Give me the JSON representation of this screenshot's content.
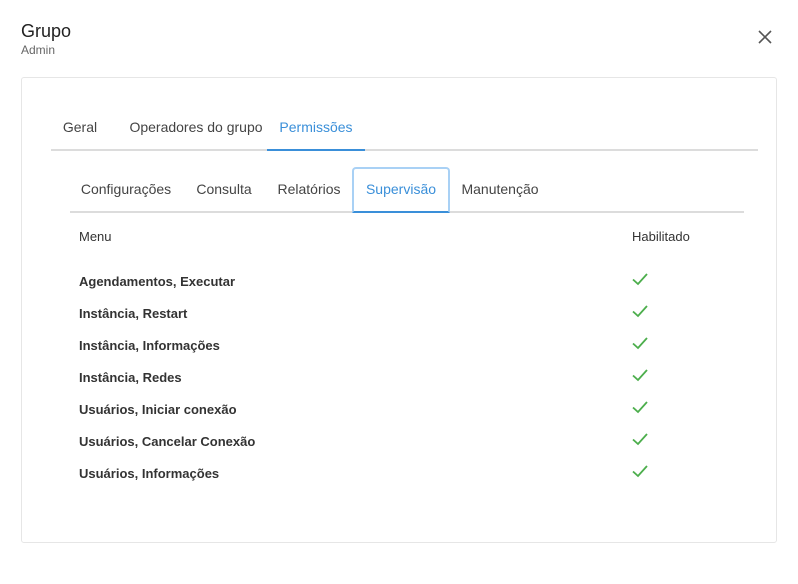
{
  "header": {
    "title": "Grupo",
    "subtitle": "Admin"
  },
  "tabs_main": [
    {
      "label": "Geral",
      "active": false
    },
    {
      "label": "Operadores do grupo",
      "active": false
    },
    {
      "label": "Permissões",
      "active": true
    }
  ],
  "tabs_sub": [
    {
      "label": "Configurações",
      "active": false
    },
    {
      "label": "Consulta",
      "active": false
    },
    {
      "label": "Relatórios",
      "active": false
    },
    {
      "label": "Supervisão",
      "active": true
    },
    {
      "label": "Manutenção",
      "active": false
    }
  ],
  "table": {
    "col_menu": "Menu",
    "col_enabled": "Habilitado",
    "rows": [
      {
        "label": "Agendamentos, Executar",
        "enabled": true
      },
      {
        "label": "Instância, Restart",
        "enabled": true
      },
      {
        "label": "Instância, Informações",
        "enabled": true
      },
      {
        "label": "Instância, Redes",
        "enabled": true
      },
      {
        "label": "Usuários, Iniciar conexão",
        "enabled": true
      },
      {
        "label": "Usuários, Cancelar Conexão",
        "enabled": true
      },
      {
        "label": "Usuários, Informações",
        "enabled": true
      }
    ]
  },
  "colors": {
    "accent": "#3a8fd9",
    "check": "#4cae4c"
  },
  "icons": {
    "close": "close-icon",
    "check": "checkmark-icon"
  }
}
